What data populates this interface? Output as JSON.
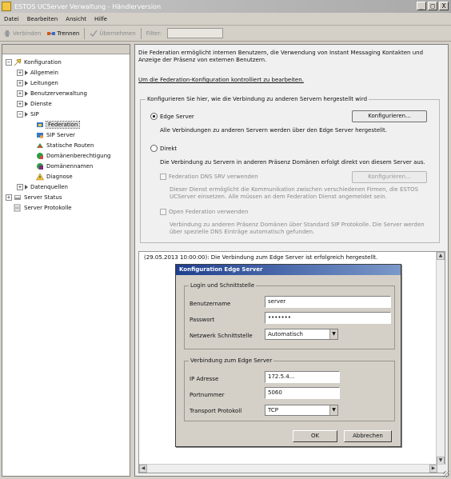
{
  "window": {
    "title": "ESTOS UCServer Verwaltung - Händlerversion",
    "minimize": "_",
    "maximize": "□",
    "close": "X"
  },
  "menu": [
    "Datei",
    "Bearbeiten",
    "Ansicht",
    "Hilfe"
  ],
  "toolbar": {
    "connect": "Verbinden",
    "disconnect": "Trennen",
    "apply": "Übernehmen",
    "filter_label": "Filter:"
  },
  "tree": {
    "root": "Konfiguration",
    "items": {
      "allgemein": "Allgemein",
      "leitungen": "Leitungen",
      "benutzerverwaltung": "Benutzerverwaltung",
      "dienste": "Dienste",
      "sip": "SIP",
      "federation": "Federation",
      "sip_server": "SIP Server",
      "statische_routen": "Statische Routen",
      "domaenenberechtigung": "Domänenberechtigung",
      "domaenennamen": "Domänennamen",
      "diagnose": "Diagnose",
      "datenquellen": "Datenquellen",
      "server_status": "Server Status",
      "server_protokolle": "Server Protokolle"
    }
  },
  "main": {
    "intro": "Die Federation ermöglicht internen Benutzern, die Verwendung von Instant Messaging Kontakten und Anzeige der Präsenz von externen Benutzern.",
    "link": "Um die Federation-Konfiguration kontrolliert zu bearbeiten.",
    "group_title": "Konfigurieren Sie hier, wie die Verbindung zu anderen Servern hergestellt wird",
    "radio_edge": "Edge Server",
    "configure_btn": "Konfigurieren...",
    "edge_desc": "Alle Verbindungen zu anderen Servern werden über den Edge Server hergestellt.",
    "radio_direct": "Direkt",
    "direct_desc": "Die Verbindung zu Servern in anderen Präsenz Domänen erfolgt direkt von diesem Server aus.",
    "federation_dns_label": "Federation DNS SRV verwenden",
    "configure_btn2": "Konfigurieren...",
    "federation_dns_desc": "Dieser Dienst ermöglicht die Kommunikation zwischen verschiedenen Firmen, die ESTOS UCServer einsetzen. Alle müssen an dem Federation Dienst angemeldet sein.",
    "open_federation_label": "Open Federation verwenden",
    "open_federation_desc": "Verbindung zu anderen Präsenz Domänen über Standard SIP Protokolle. Die Server werden über spezielle DNS Einträge automatisch gefunden."
  },
  "log": {
    "line": "(29.05.2013 10:00:00): Die Verbindung zum Edge Server ist erfolgreich hergestellt."
  },
  "dialog": {
    "title": "Konfiguration Edge Server",
    "login_group": "Login und Schnittstelle",
    "username_label": "Benutzername",
    "username_value": "server",
    "password_label": "Passwort",
    "password_value": "•••••••",
    "interface_label": "Netzwerk Schnittstelle",
    "interface_value": "Automatisch",
    "connection_group": "Verbindung zum Edge Server",
    "ip_label": "IP Adresse",
    "ip_value": "172.5.4...",
    "port_label": "Portnummer",
    "port_value": "5060",
    "protocol_label": "Transport Protokoll",
    "protocol_value": "TCP",
    "ok": "OK",
    "cancel": "Abbrechen"
  },
  "colors": {
    "window_bg": "#d4d0c8",
    "dialog_title_start": "#1e3f8f",
    "dialog_title_end": "#7b98c9"
  }
}
